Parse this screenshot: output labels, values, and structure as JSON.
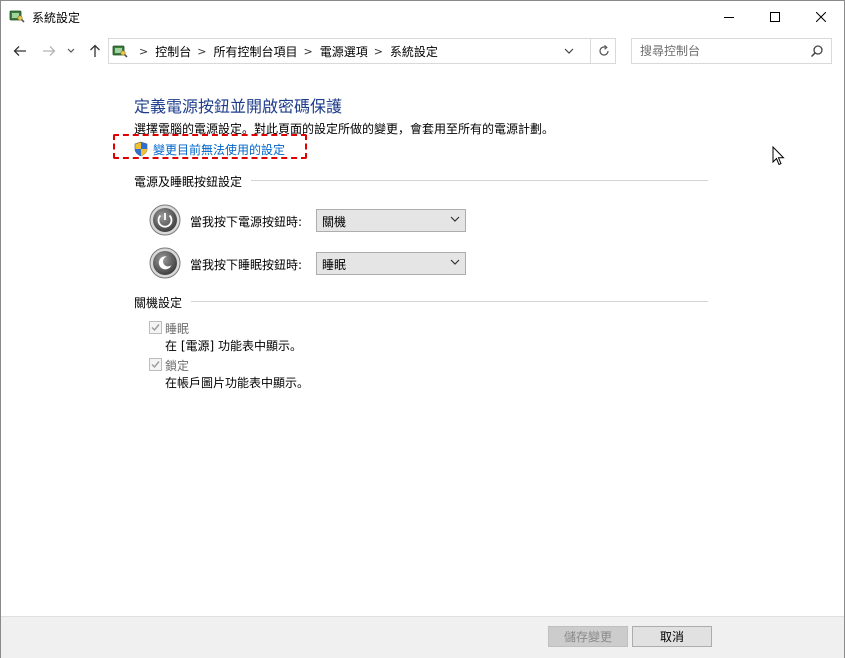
{
  "window": {
    "title": "系統設定"
  },
  "address": {
    "crumbs": [
      "控制台",
      "所有控制台項目",
      "電源選項",
      "系統設定"
    ]
  },
  "search": {
    "placeholder": "搜尋控制台"
  },
  "content": {
    "title": "定義電源按鈕並開啟密碼保護",
    "description": "選擇電腦的電源設定。對此頁面的設定所做的變更，會套用至所有的電源計劃。",
    "change_link": "變更目前無法使用的設定"
  },
  "power_section": {
    "heading": "電源及睡眠按鈕設定",
    "power_button_label": "當我按下電源按鈕時:",
    "power_button_value": "關機",
    "sleep_button_label": "當我按下睡眠按鈕時:",
    "sleep_button_value": "睡眠"
  },
  "shutdown_section": {
    "heading": "關機設定",
    "items": [
      {
        "label": "睡眠",
        "description": "在 [電源] 功能表中顯示。",
        "checked": true,
        "disabled": true
      },
      {
        "label": "鎖定",
        "description": "在帳戶圖片功能表中顯示。",
        "checked": true,
        "disabled": true
      }
    ]
  },
  "footer": {
    "save_label": "儲存變更",
    "cancel_label": "取消"
  },
  "colors": {
    "title_blue": "#1e3d8c",
    "link_blue": "#0066cc",
    "highlight_red": "#e00000"
  }
}
